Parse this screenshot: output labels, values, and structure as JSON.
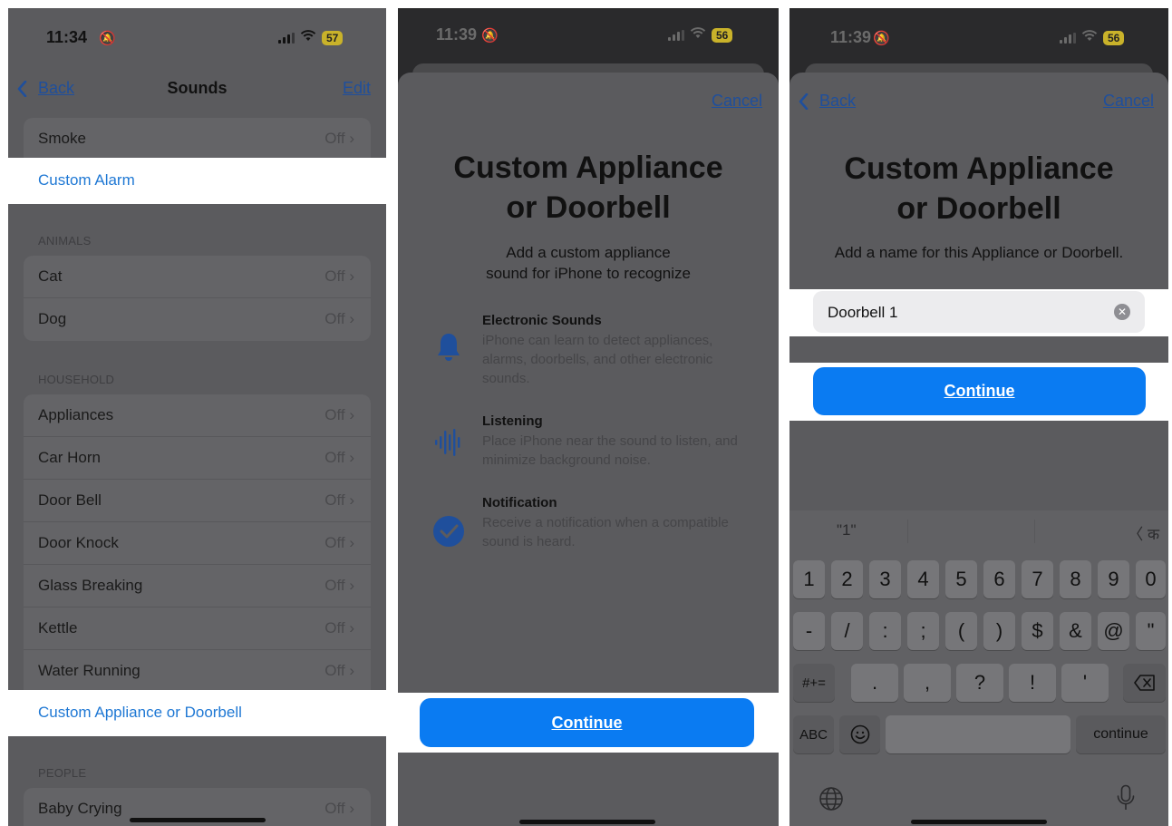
{
  "panel1": {
    "status": {
      "time": "11:34",
      "battery": "57"
    },
    "nav": {
      "back": "Back",
      "title": "Sounds",
      "edit": "Edit"
    },
    "alarms": {
      "smoke": {
        "label": "Smoke",
        "value": "Off"
      },
      "custom_alarm": "Custom Alarm"
    },
    "animals": {
      "header": "ANIMALS",
      "items": [
        {
          "label": "Cat",
          "value": "Off"
        },
        {
          "label": "Dog",
          "value": "Off"
        }
      ]
    },
    "household": {
      "header": "HOUSEHOLD",
      "items": [
        {
          "label": "Appliances",
          "value": "Off"
        },
        {
          "label": "Car Horn",
          "value": "Off"
        },
        {
          "label": "Door Bell",
          "value": "Off"
        },
        {
          "label": "Door Knock",
          "value": "Off"
        },
        {
          "label": "Glass Breaking",
          "value": "Off"
        },
        {
          "label": "Kettle",
          "value": "Off"
        },
        {
          "label": "Water Running",
          "value": "Off"
        }
      ],
      "custom": "Custom Appliance or Doorbell"
    },
    "people": {
      "header": "PEOPLE",
      "items": [
        {
          "label": "Baby Crying",
          "value": "Off"
        }
      ]
    }
  },
  "panel2": {
    "status": {
      "time": "11:39",
      "battery": "56"
    },
    "cancel": "Cancel",
    "title_line1": "Custom Appliance",
    "title_line2": "or Doorbell",
    "subtitle_line1": "Add a custom appliance",
    "subtitle_line2": "sound for iPhone to recognize",
    "features": [
      {
        "title": "Electronic Sounds",
        "desc": "iPhone can learn to detect appliances, alarms, doorbells, and other electronic sounds.",
        "icon": "bell-icon"
      },
      {
        "title": "Listening",
        "desc": "Place iPhone near the sound to listen, and minimize background noise.",
        "icon": "waveform-icon"
      },
      {
        "title": "Notification",
        "desc": "Receive a notification when a compatible sound is heard.",
        "icon": "checkmark-circle-icon"
      }
    ],
    "continue": "Continue"
  },
  "panel3": {
    "status": {
      "time": "11:39",
      "battery": "56"
    },
    "back": "Back",
    "cancel": "Cancel",
    "title_line1": "Custom Appliance",
    "title_line2": "or Doorbell",
    "subtitle": "Add a name for this Appliance or Doorbell.",
    "input_value": "Doorbell 1",
    "continue": "Continue",
    "keyboard": {
      "suggestion": "\"1\"",
      "suggestion_right": "〈 क",
      "row1": [
        "1",
        "2",
        "3",
        "4",
        "5",
        "6",
        "7",
        "8",
        "9",
        "0"
      ],
      "row2": [
        "-",
        "/",
        ":",
        ";",
        "(",
        ")",
        "$",
        "&",
        "@",
        "\""
      ],
      "row3_left": "#+=",
      "row3": [
        ".",
        ",",
        "?",
        "!",
        "'"
      ],
      "abc": "ABC",
      "return": "continue"
    }
  },
  "colors": {
    "accent": "#0a7bf2",
    "link": "#1f4f9c",
    "highlight_text": "#1f78d4",
    "dim_overlay": "#5b5b5e",
    "battery": "#c9b22a"
  }
}
